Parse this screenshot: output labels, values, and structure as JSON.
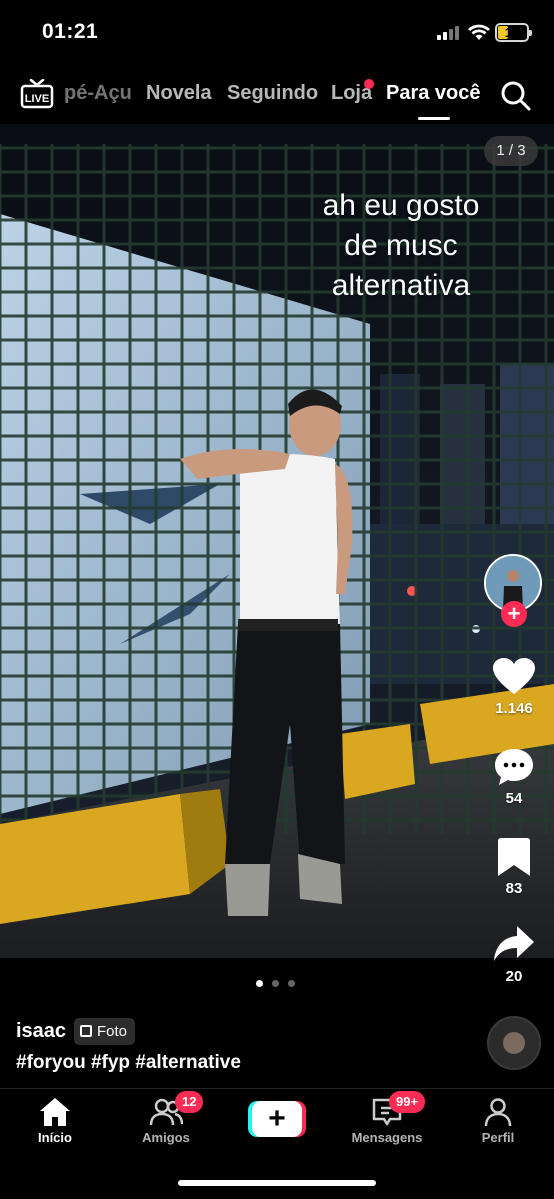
{
  "status_bar": {
    "time": "01:21",
    "battery": "10"
  },
  "top_nav": {
    "tabs": [
      {
        "label": "pé-Açu"
      },
      {
        "label": "Novela"
      },
      {
        "label": "Seguindo"
      },
      {
        "label": "Loja"
      },
      {
        "label": "Para você"
      }
    ],
    "active_tab": "Para você",
    "live_icon": "live-tv-icon",
    "search_icon": "search-icon"
  },
  "post": {
    "photo_counter": "1 / 3",
    "overlay_lines": [
      "ah eu gosto",
      "de musc",
      "alternativa"
    ],
    "username": "isaac",
    "type_badge": "Foto",
    "hashtags": "#foryou #fyp #alternative",
    "likes": "1.146",
    "comments": "54",
    "saves": "83",
    "shares": "20",
    "current_slide": 1,
    "total_slides": 3
  },
  "bottom_nav": {
    "items": [
      {
        "label": "Início",
        "icon": "home-icon"
      },
      {
        "label": "Amigos",
        "icon": "friends-icon",
        "badge": "12"
      },
      {
        "label": "",
        "icon": "create-plus-icon"
      },
      {
        "label": "Mensagens",
        "icon": "inbox-icon",
        "badge": "99+"
      },
      {
        "label": "Perfil",
        "icon": "profile-icon"
      }
    ]
  },
  "colors": {
    "accent": "#fe2c55",
    "cyan": "#25f4ee",
    "battery": "#f4c92c"
  }
}
